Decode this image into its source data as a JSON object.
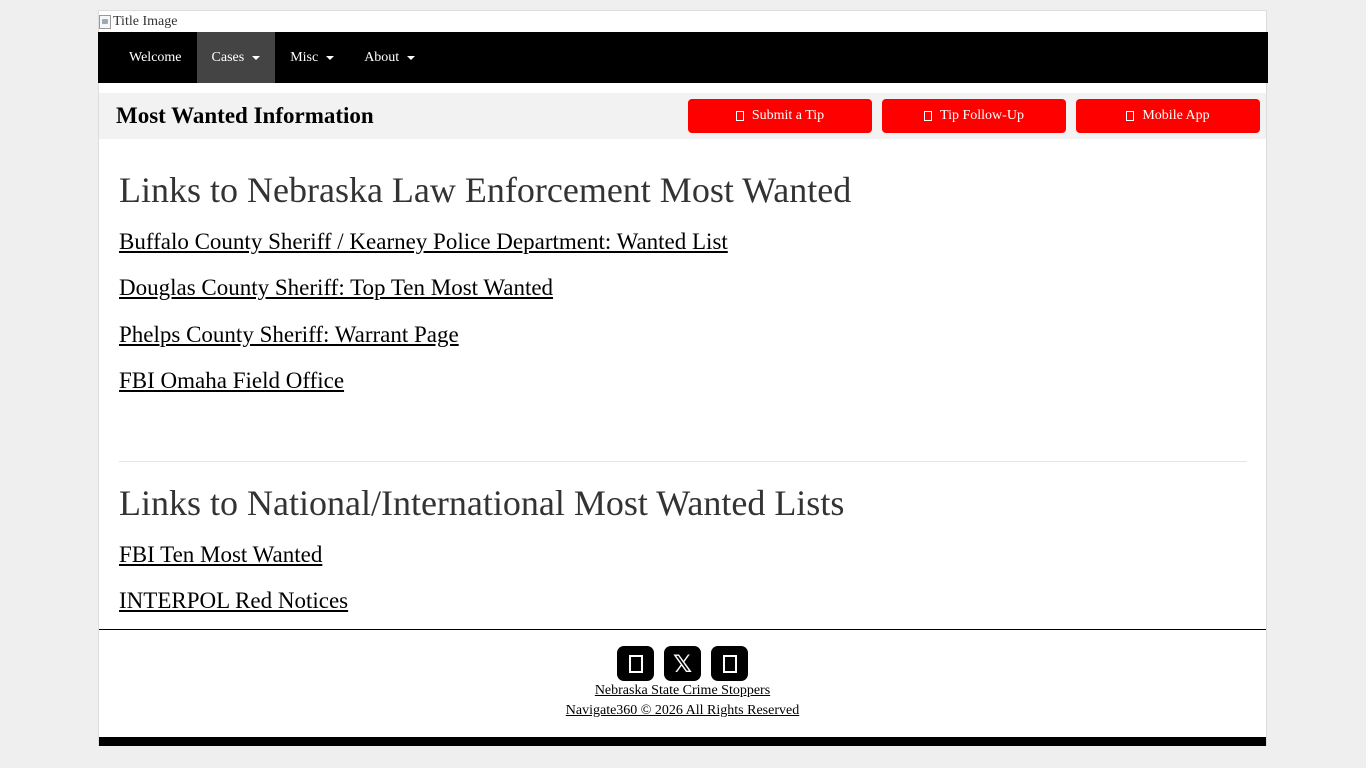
{
  "header": {
    "title_image_alt": "Title Image"
  },
  "nav": {
    "items": [
      {
        "label": "Welcome",
        "dropdown": false,
        "active": false
      },
      {
        "label": "Cases",
        "dropdown": true,
        "active": true
      },
      {
        "label": "Misc",
        "dropdown": true,
        "active": false
      },
      {
        "label": "About",
        "dropdown": true,
        "active": false
      }
    ]
  },
  "info_bar": {
    "title": "Most Wanted Information",
    "buttons": [
      {
        "label": "Submit a Tip",
        "icon": "shield-icon"
      },
      {
        "label": "Tip Follow-Up",
        "icon": "clipboard-icon"
      },
      {
        "label": "Mobile App",
        "icon": "mobile-icon"
      }
    ],
    "button_color": "#ff0000"
  },
  "sections": [
    {
      "heading": "Links to Nebraska Law Enforcement Most Wanted",
      "links": [
        "Buffalo County Sheriff / Kearney Police Department:  Wanted List",
        "Douglas County Sheriff:  Top Ten Most Wanted",
        "Phelps County Sheriff:  Warrant Page",
        "FBI Omaha Field Office"
      ]
    },
    {
      "heading": "Links to National/International Most Wanted Lists",
      "links": [
        "FBI Ten Most Wanted",
        "INTERPOL Red Notices"
      ]
    }
  ],
  "footer": {
    "social": [
      {
        "icon": "facebook-icon"
      },
      {
        "icon": "x-icon",
        "glyph": "𝕏"
      },
      {
        "icon": "instagram-icon"
      }
    ],
    "org_link": "Nebraska State Crime Stoppers",
    "copyright_link": "Navigate360 © 2026 All Rights Reserved"
  }
}
